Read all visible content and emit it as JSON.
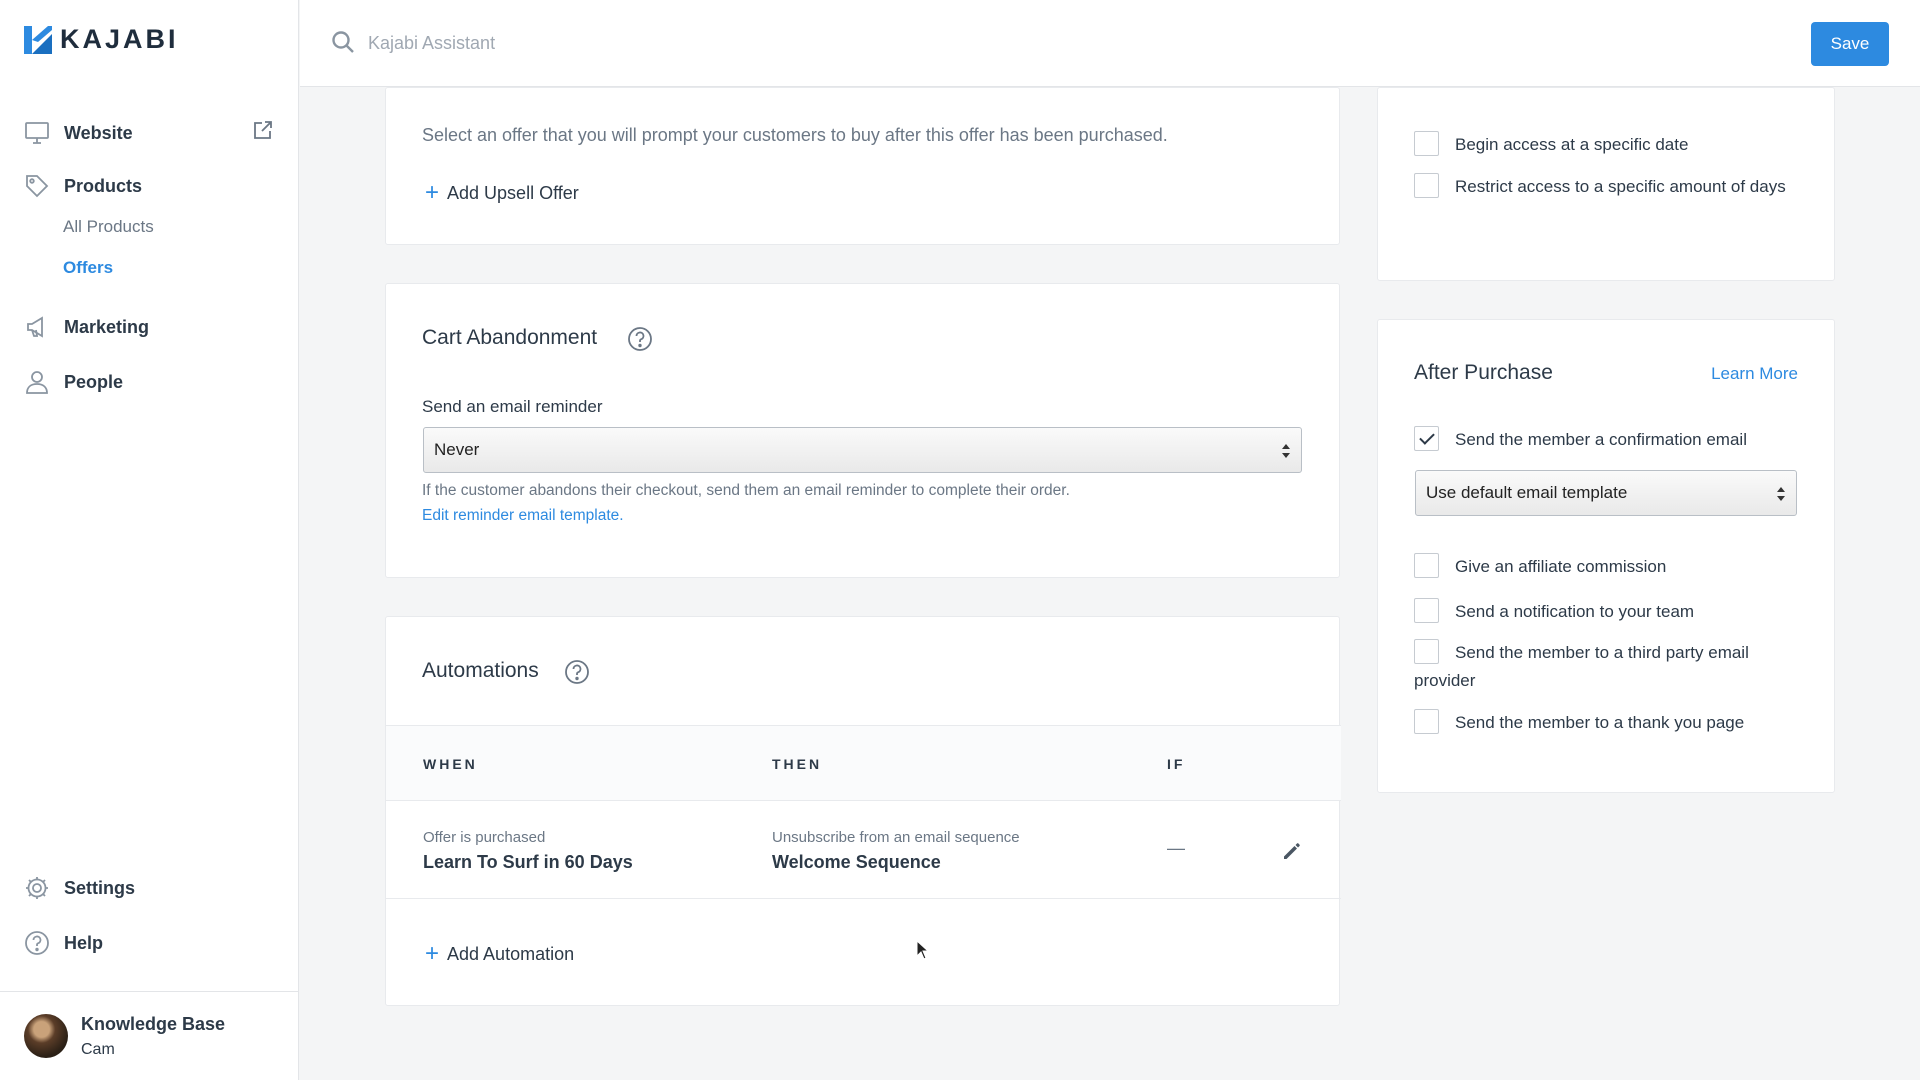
{
  "app": {
    "logo_text": "KAJABI",
    "brand_color": "#2d8ae0"
  },
  "search": {
    "placeholder": "Kajabi Assistant"
  },
  "toolbar": {
    "save_label": "Save"
  },
  "sidebar": {
    "items": [
      {
        "label": "Website",
        "icon": "monitor-icon"
      },
      {
        "label": "Products",
        "icon": "tag-icon"
      },
      {
        "label": "Marketing",
        "icon": "megaphone-icon"
      },
      {
        "label": "People",
        "icon": "person-icon"
      }
    ],
    "product_subitems": [
      {
        "label": "All Products"
      },
      {
        "label": "Offers",
        "active": true
      }
    ],
    "bottom_items": [
      {
        "label": "Settings",
        "icon": "gear-icon"
      },
      {
        "label": "Help",
        "icon": "help-icon"
      }
    ],
    "user": {
      "name": "Knowledge Base",
      "sub": "Cam"
    }
  },
  "upsell": {
    "description": "Select an offer that you will prompt your customers to buy after this offer has been purchased.",
    "add_label": "Add Upsell Offer"
  },
  "cart": {
    "title": "Cart Abandonment",
    "field_label": "Send an email reminder",
    "select_value": "Never",
    "help_text": "If the customer abandons their checkout, send them an email reminder to complete their order.",
    "edit_link": "Edit reminder email template."
  },
  "automations": {
    "title": "Automations",
    "columns": [
      "WHEN",
      "THEN",
      "IF"
    ],
    "rows": [
      {
        "when_sub": "Offer is purchased",
        "when_main": "Learn To Surf in 60 Days",
        "then_sub": "Unsubscribe from an email sequence",
        "then_main": "Welcome Sequence",
        "if": "—"
      }
    ],
    "add_label": "Add Automation"
  },
  "access": {
    "options": [
      {
        "label": "Begin access at a specific date",
        "checked": false
      },
      {
        "label": "Restrict access to a specific amount of days",
        "checked": false
      }
    ]
  },
  "after_purchase": {
    "title": "After Purchase",
    "learn_more": "Learn More",
    "confirmation": {
      "label": "Send the member a confirmation email",
      "checked": true
    },
    "template_select": "Use default email template",
    "options": [
      {
        "label": "Give an affiliate commission",
        "checked": false
      },
      {
        "label": "Send a notification to your team",
        "checked": false
      },
      {
        "label": "Send the member to a third party email provider",
        "checked": false
      },
      {
        "label": "Send the member to a thank you page",
        "checked": false
      }
    ]
  }
}
